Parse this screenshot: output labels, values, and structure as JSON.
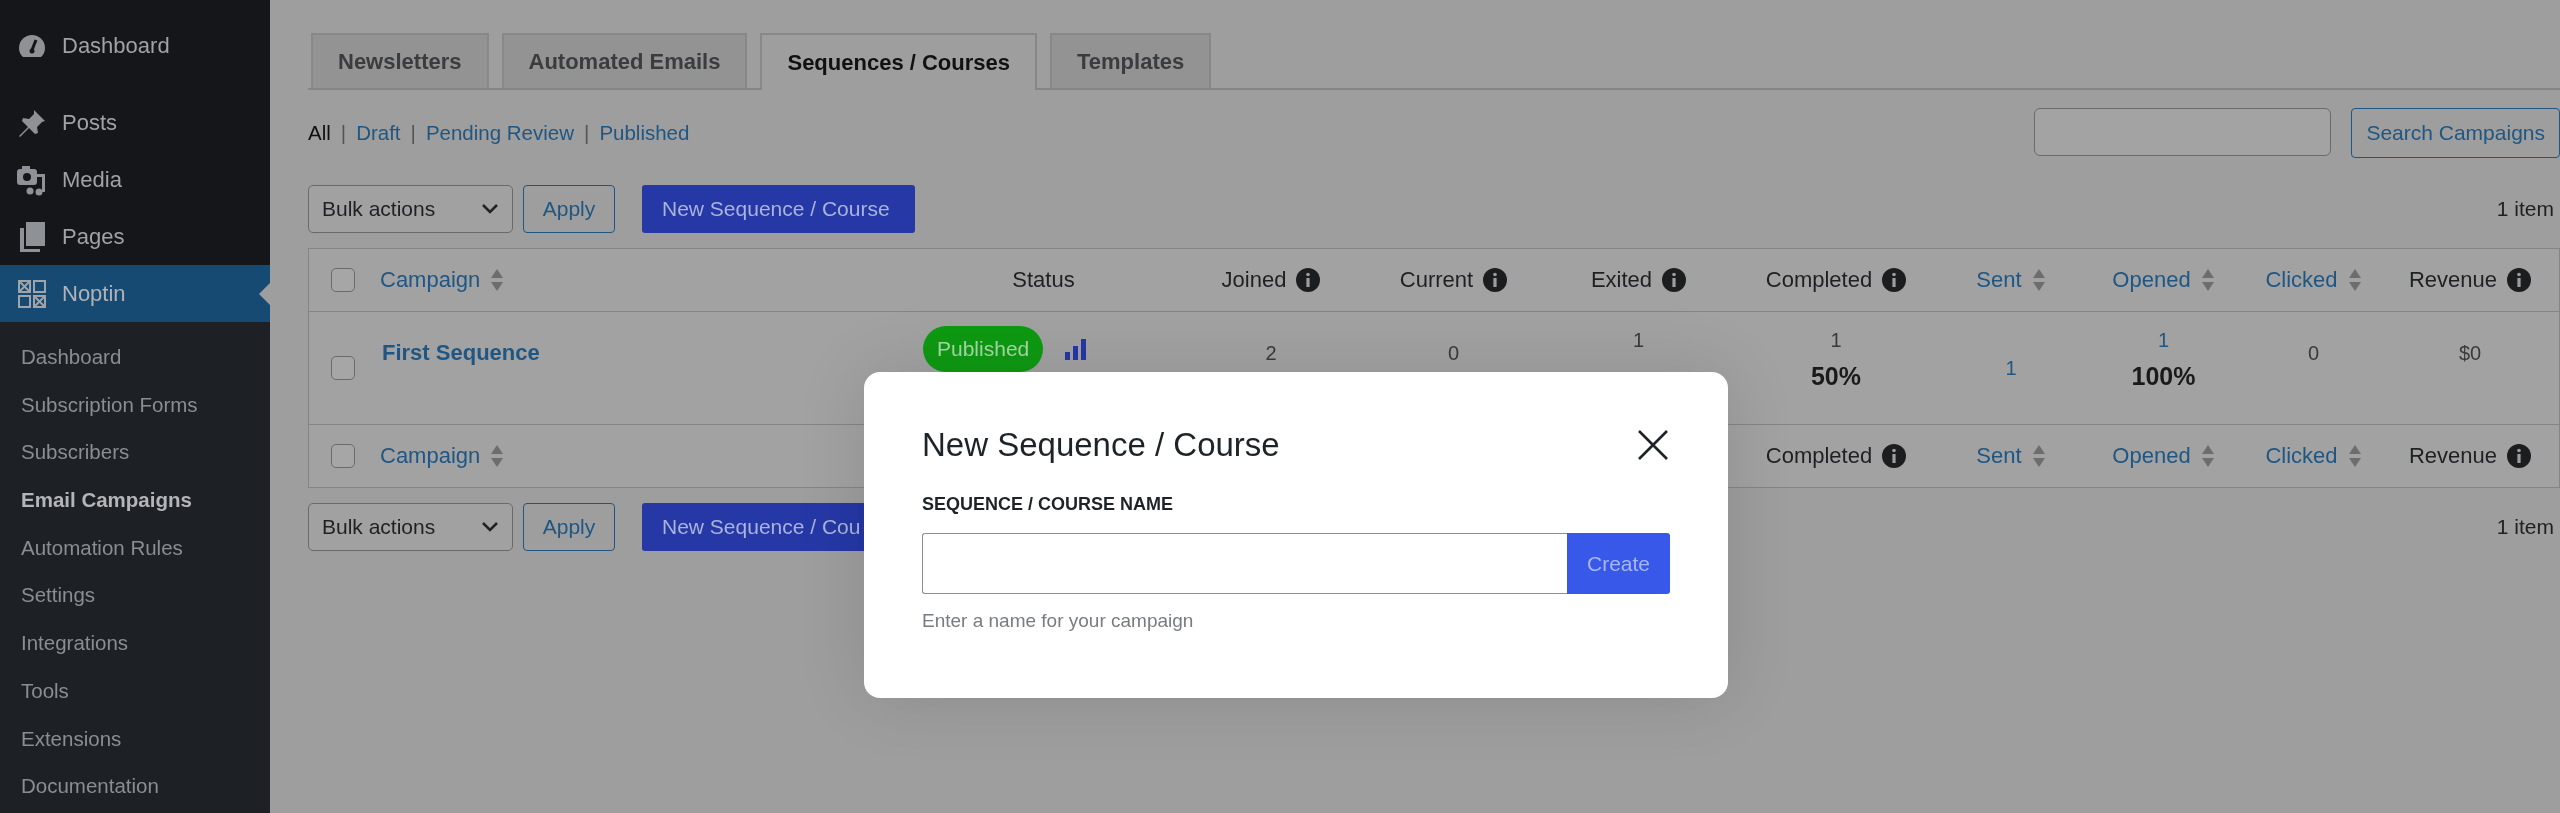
{
  "sidebar": {
    "items": [
      {
        "label": "Dashboard",
        "selected": false
      },
      {
        "label": "Posts",
        "selected": false
      },
      {
        "label": "Media",
        "selected": false
      },
      {
        "label": "Pages",
        "selected": false
      },
      {
        "label": "Noptin",
        "selected": true
      }
    ],
    "submenu": [
      {
        "label": "Dashboard",
        "selected": false
      },
      {
        "label": "Subscription Forms",
        "selected": false
      },
      {
        "label": "Subscribers",
        "selected": false
      },
      {
        "label": "Email Campaigns",
        "selected": true
      },
      {
        "label": "Automation Rules",
        "selected": false
      },
      {
        "label": "Settings",
        "selected": false
      },
      {
        "label": "Integrations",
        "selected": false
      },
      {
        "label": "Tools",
        "selected": false
      },
      {
        "label": "Extensions",
        "selected": false
      },
      {
        "label": "Documentation",
        "selected": false
      }
    ]
  },
  "tabs": [
    {
      "label": "Newsletters",
      "selected": false
    },
    {
      "label": "Automated Emails",
      "selected": false
    },
    {
      "label": "Sequences / Courses",
      "selected": true
    },
    {
      "label": "Templates",
      "selected": false
    }
  ],
  "filters": {
    "separator": "|",
    "items": [
      {
        "label": "All",
        "selected": true
      },
      {
        "label": "Draft",
        "selected": false
      },
      {
        "label": "Pending Review",
        "selected": false
      },
      {
        "label": "Published",
        "selected": false
      }
    ]
  },
  "search": {
    "button": "Search Campaigns"
  },
  "top_toolbar": {
    "bulk_actions": "Bulk actions",
    "apply": "Apply",
    "new_button": "New Sequence / Course",
    "count": "1 item"
  },
  "table": {
    "select_all_checked": false,
    "columns": [
      {
        "label": "Campaign",
        "kind": "sortable"
      },
      {
        "label": "Status",
        "kind": "plain"
      },
      {
        "label": "Joined",
        "kind": "info"
      },
      {
        "label": "Current",
        "kind": "info"
      },
      {
        "label": "Exited",
        "kind": "info"
      },
      {
        "label": "Completed",
        "kind": "info"
      },
      {
        "label": "Sent",
        "kind": "sortable"
      },
      {
        "label": "Opened",
        "kind": "sortable"
      },
      {
        "label": "Clicked",
        "kind": "sortable"
      },
      {
        "label": "Revenue",
        "kind": "info"
      }
    ],
    "rows": [
      {
        "checked": false,
        "cells": [
          {
            "kind": "title",
            "text": "First Sequence"
          },
          {
            "kind": "status",
            "text": "Published",
            "color": "#0e9a12"
          },
          {
            "kind": "stat",
            "value": "2"
          },
          {
            "kind": "stat",
            "value": "0"
          },
          {
            "kind": "pair",
            "value": "1"
          },
          {
            "kind": "pair",
            "value": "1",
            "rate": "50%"
          },
          {
            "kind": "link",
            "value": "1"
          },
          {
            "kind": "link-pair",
            "value": "1",
            "rate": "100%"
          },
          {
            "kind": "stat",
            "value": "0"
          },
          {
            "kind": "stat",
            "value": "$0"
          }
        ]
      }
    ],
    "footer": {
      "select_all_checked": false,
      "columns": [
        {
          "label": "Campaign",
          "kind": "sortable"
        },
        {
          "label": "Completed",
          "kind": "info"
        },
        {
          "label": "Sent",
          "kind": "sortable"
        },
        {
          "label": "Opened",
          "kind": "sortable"
        },
        {
          "label": "Clicked",
          "kind": "sortable"
        },
        {
          "label": "Revenue",
          "kind": "info"
        }
      ]
    }
  },
  "bottom_toolbar": {
    "bulk_actions": "Bulk actions",
    "apply": "Apply",
    "new_button": "New Sequence / Cou",
    "count": "1 item"
  },
  "modal": {
    "title": "New Sequence / Course",
    "field_label": "SEQUENCE / COURSE NAME",
    "button": "Create",
    "help": "Enter a name for your campaign"
  }
}
